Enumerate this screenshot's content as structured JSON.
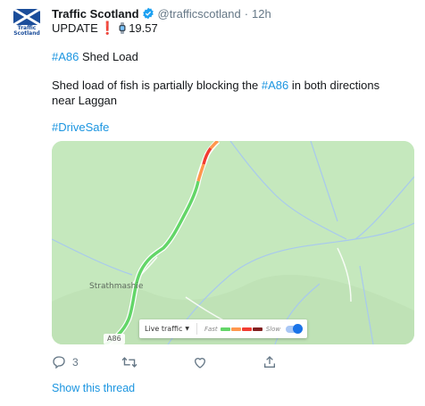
{
  "tweet": {
    "display_name": "Traffic Scotland",
    "handle": "@trafficscotland",
    "dot": "·",
    "time": "12h",
    "avatar_text_1": "Traffic",
    "avatar_text_2": "Scotland",
    "line1_text": "UPDATE",
    "line1_exclaim": "❗",
    "line1_time": "19.57",
    "title_hashtag": "#A86",
    "title_text": " Shed Load",
    "body_prefix": "Shed load of fish is partially blocking the ",
    "body_hashtag": "#A86",
    "body_suffix": " in both directions near Laggan",
    "drivesafe": "#DriveSafe"
  },
  "map": {
    "place_label": "Strathmashie",
    "road_label": "A86",
    "legend": {
      "live_label": "Live traffic",
      "caret": "▼",
      "fast_label": "Fast",
      "slow_label": "Slow",
      "colors": [
        "#63d668",
        "#ff974d",
        "#f23c32",
        "#811f1f"
      ]
    }
  },
  "actions": {
    "reply_count": "3",
    "retweet_count": "",
    "like_count": ""
  },
  "show_thread": "Show this thread",
  "colors": {
    "link": "#1b95e0",
    "muted": "#657786",
    "map_bg": "#c5e8bd",
    "road_green": "#63d668",
    "road_orange": "#ff974d",
    "road_red": "#f23c32"
  }
}
